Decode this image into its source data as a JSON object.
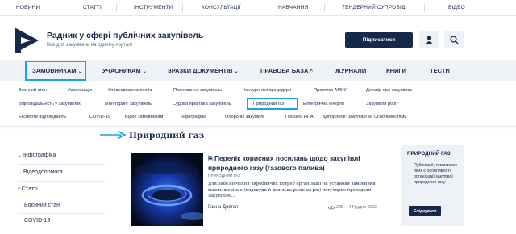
{
  "topnav": {
    "items": [
      "НОВИНИ",
      "СТАТТІ",
      "ІНСТРУМЕНТИ",
      "КОНСУЛЬТАЦІЇ",
      "НАВЧАННЯ",
      "ТЕНДЕРНИЙ СУПРОВІД",
      "ВІДЕО"
    ]
  },
  "header": {
    "title": "Радник у сфері публічних закупівель",
    "subtitle": "Все для закупівель на одному порталі",
    "subscribe_label": "Підписатися",
    "user_icon": "user-icon",
    "search_icon": "search-icon"
  },
  "mainmenu": {
    "items": [
      {
        "label": "ЗАМОВНИКАМ",
        "has_dropdown": true,
        "active": true
      },
      {
        "label": "УЧАСНИКАМ",
        "has_dropdown": true
      },
      {
        "label": "ЗРАЗКИ ДОКУМЕНТІВ",
        "has_dropdown": true
      },
      {
        "label": "ПРАВОВА БАЗА",
        "has_dropdown": true
      },
      {
        "label": "ЖУРНАЛИ",
        "has_dropdown": false
      },
      {
        "label": "КНИГИ",
        "has_dropdown": false
      },
      {
        "label": "ТЕСТИ",
        "has_dropdown": false
      }
    ]
  },
  "submenu": {
    "row1": [
      "Воєнний стан",
      "Локалізація",
      "Уповноважена особа",
      "Планування закупівель",
      "Конкурентні процедури",
      "Практика АМКУ",
      "Договір про закупівлю"
    ],
    "row2": [
      "Відповідальність у закупівлях",
      "Моніторинг закупівель",
      "Судова практика закупівель",
      "Природний газ",
      "Електрична енергія",
      "Закупівля робіт"
    ],
    "row3": [
      "Експерти відповідають",
      "COVID-19",
      "Відео замовникам",
      "Інфографіка",
      "Оборонні закупівлі",
      "Проєкти НПА",
      "\"Допорогові\" закупівлі за Особливостями"
    ]
  },
  "page": {
    "title": "Природний газ"
  },
  "sidebar": {
    "items": [
      {
        "label": "Інфографіка",
        "chevron": "⌄"
      },
      {
        "label": "Відеодопомога",
        "chevron": "⌄"
      },
      {
        "label": "Статті",
        "chevron": "^"
      }
    ],
    "subitems": [
      "Воєнний стан",
      "COVID-19"
    ]
  },
  "article": {
    "title": "Перелік корисних посилань щодо закупівлі природного газу (газового палива)",
    "category": "ПРИРОДНИЙ ГАЗ",
    "excerpt": "Для забезпечення виробничих потреб організації чи установи замовники мають шорічно (подекуди й декілька разів на рік) регулярно проводити закупівлю...",
    "author": "Ганна Довгая",
    "views": "205",
    "date": "4 Грудня 2022"
  },
  "widget": {
    "title": "ПРИРОДНИЙ ГАЗ",
    "text": "Публікації, тематикою яких є особливості організації закупівлі природного газу",
    "button_label": "Слідкувати"
  },
  "colors": {
    "navy": "#16294d",
    "highlight": "#1aa1e6",
    "menu_bg": "#eef1f6"
  }
}
